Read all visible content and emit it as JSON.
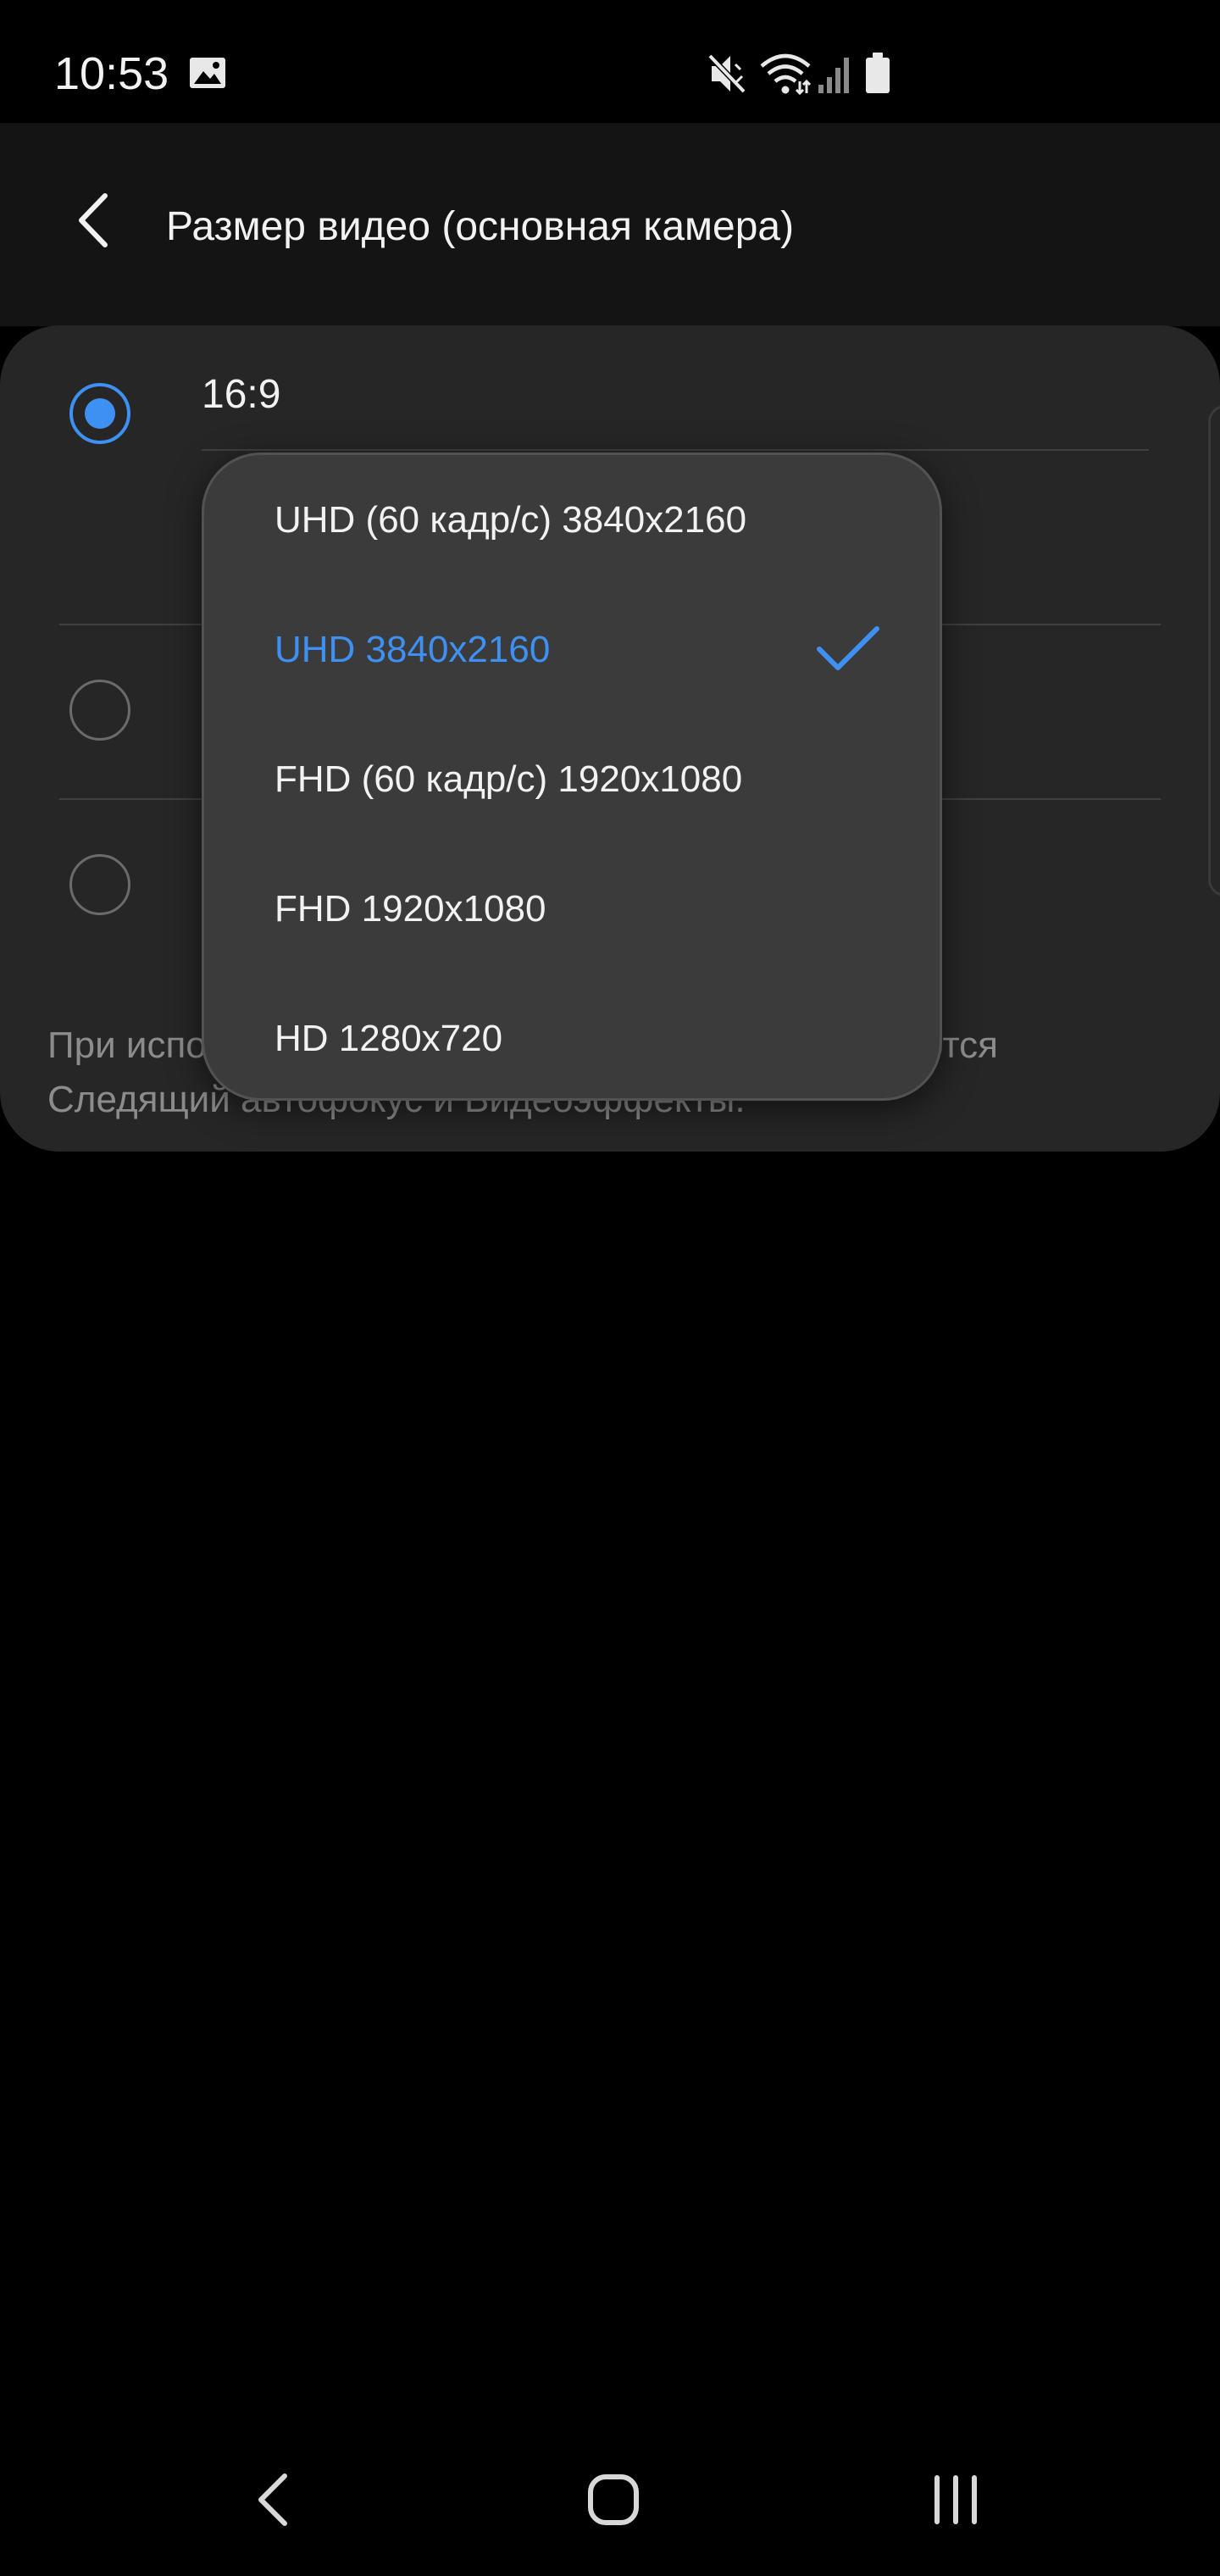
{
  "status_bar": {
    "time": "10:53",
    "icons": [
      "gallery-icon",
      "mute-icon",
      "wifi-icon",
      "signal-icon",
      "battery-icon"
    ]
  },
  "header": {
    "title": "Размер видео (основная камера)",
    "back_icon": "chevron-left-icon"
  },
  "card": {
    "options": [
      {
        "label": "16:9",
        "checked": true
      },
      {
        "label": "",
        "checked": false
      },
      {
        "label": "",
        "checked": false
      }
    ],
    "note": "При использовании этого размера не поддерживаются Следящий автофокус и Видеоэффекты."
  },
  "dropdown": {
    "items": [
      {
        "label": "UHD (60 кадр/с) 3840x2160",
        "selected": false
      },
      {
        "label": "UHD 3840x2160",
        "selected": true
      },
      {
        "label": "FHD (60 кадр/с) 1920x1080",
        "selected": false
      },
      {
        "label": "FHD 1920x1080",
        "selected": false
      },
      {
        "label": "HD 1280x720",
        "selected": false
      }
    ]
  },
  "nav_bar": {
    "buttons": [
      "back-icon",
      "home-icon",
      "recents-icon"
    ]
  },
  "colors": {
    "accent": "#3e91f3",
    "background": "#000000",
    "card": "#262626",
    "popup": "#3b3b3b",
    "note_text": "#8c8c8c"
  }
}
